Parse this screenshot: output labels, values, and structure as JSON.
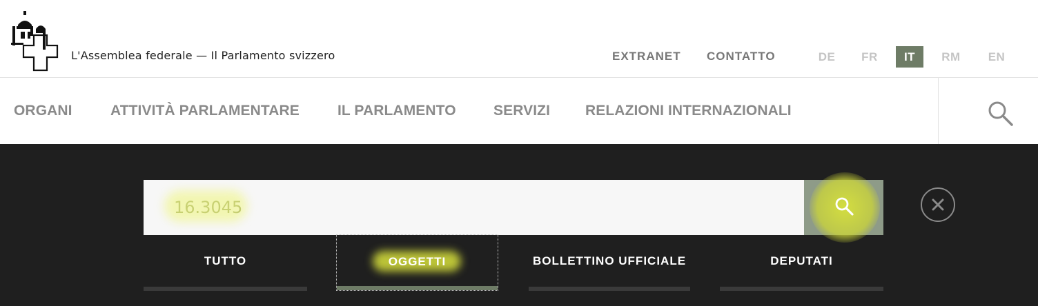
{
  "header": {
    "site_title": "L'Assemblea federale — Il Parlamento svizzero",
    "meta_links": [
      "EXTRANET",
      "CONTATTO"
    ],
    "languages": [
      {
        "code": "DE",
        "active": false
      },
      {
        "code": "FR",
        "active": false
      },
      {
        "code": "IT",
        "active": true
      },
      {
        "code": "RM",
        "active": false
      },
      {
        "code": "EN",
        "active": false
      }
    ]
  },
  "nav": {
    "items": [
      "ORGANI",
      "ATTIVITÀ PARLAMENTARE",
      "IL PARLAMENTO",
      "SERVIZI",
      "RELAZIONI INTERNAZIONALI"
    ],
    "search_icon": "search-icon"
  },
  "search": {
    "value": "16.3045",
    "button_icon": "search-icon",
    "close_icon": "close-icon",
    "tabs": [
      {
        "label": "TUTTO",
        "active": false
      },
      {
        "label": "OGGETTI",
        "active": true
      },
      {
        "label": "BOLLETTINO UFFICIALE",
        "active": false
      },
      {
        "label": "DEPUTATI",
        "active": false
      }
    ]
  },
  "colors": {
    "accent": "#6e7c66",
    "panel_bg": "#1f1f1f",
    "highlight": "#d7e13c"
  }
}
